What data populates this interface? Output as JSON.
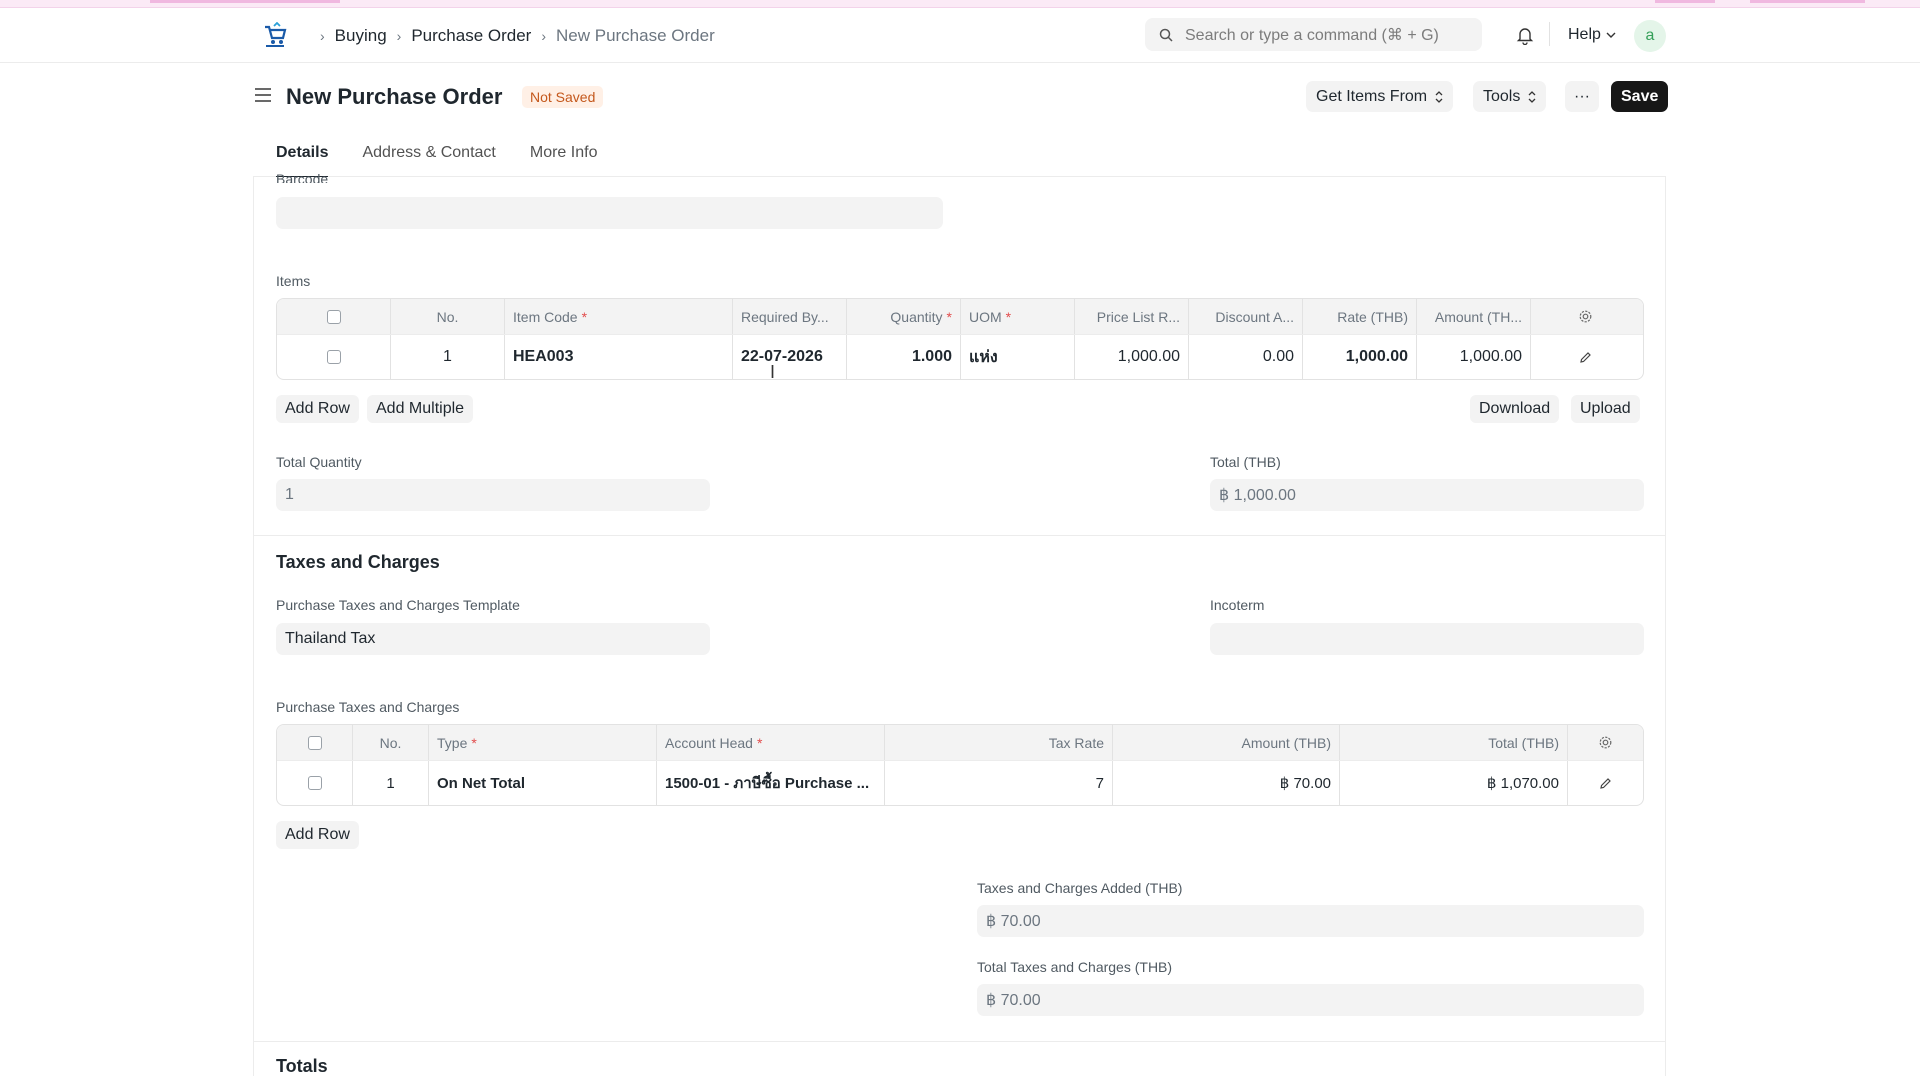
{
  "navbar": {
    "breadcrumbs": [
      "Buying",
      "Purchase Order",
      "New Purchase Order"
    ],
    "search_placeholder": "Search or type a command (⌘ + G)",
    "help_label": "Help",
    "avatar_initial": "a"
  },
  "page": {
    "title": "New Purchase Order",
    "status": "Not Saved",
    "get_items_label": "Get Items From",
    "tools_label": "Tools",
    "more_label": "···",
    "save_label": "Save"
  },
  "tabs": [
    "Details",
    "Address & Contact",
    "More Info"
  ],
  "barcode": {
    "label": "Barcode",
    "value": ""
  },
  "items": {
    "label": "Items",
    "headers": [
      "No.",
      "Item Code",
      "Required By...",
      "Quantity",
      "UOM",
      "Price List R...",
      "Discount A...",
      "Rate (THB)",
      "Amount (TH..."
    ],
    "rows": [
      {
        "no": "1",
        "item_code": "HEA003",
        "required_by": "22-07-2026",
        "quantity": "1.000",
        "uom": "แห่ง",
        "price_list_rate": "1,000.00",
        "discount": "0.00",
        "rate": "1,000.00",
        "amount": "1,000.00"
      }
    ],
    "add_row_label": "Add Row",
    "add_multiple_label": "Add Multiple",
    "download_label": "Download",
    "upload_label": "Upload"
  },
  "totals_qty": {
    "total_quantity_label": "Total Quantity",
    "total_quantity_value": "1",
    "total_label": "Total (THB)",
    "total_value": "฿ 1,000.00"
  },
  "taxes": {
    "section_title": "Taxes and Charges",
    "template_label": "Purchase Taxes and Charges Template",
    "template_value": "Thailand Tax",
    "incoterm_label": "Incoterm",
    "incoterm_value": "",
    "table_label": "Purchase Taxes and Charges",
    "headers": [
      "No.",
      "Type",
      "Account Head",
      "Tax Rate",
      "Amount (THB)",
      "Total (THB)"
    ],
    "rows": [
      {
        "no": "1",
        "type": "On Net Total",
        "account_head": "1500-01 - ภาษีซื้อ Purchase ...",
        "tax_rate": "7",
        "amount": "฿ 70.00",
        "total": "฿ 1,070.00"
      }
    ],
    "add_row_label": "Add Row",
    "added_label": "Taxes and Charges Added (THB)",
    "added_value": "฿ 70.00",
    "total_taxes_label": "Total Taxes and Charges (THB)",
    "total_taxes_value": "฿ 70.00"
  },
  "totals_section_title": "Totals"
}
